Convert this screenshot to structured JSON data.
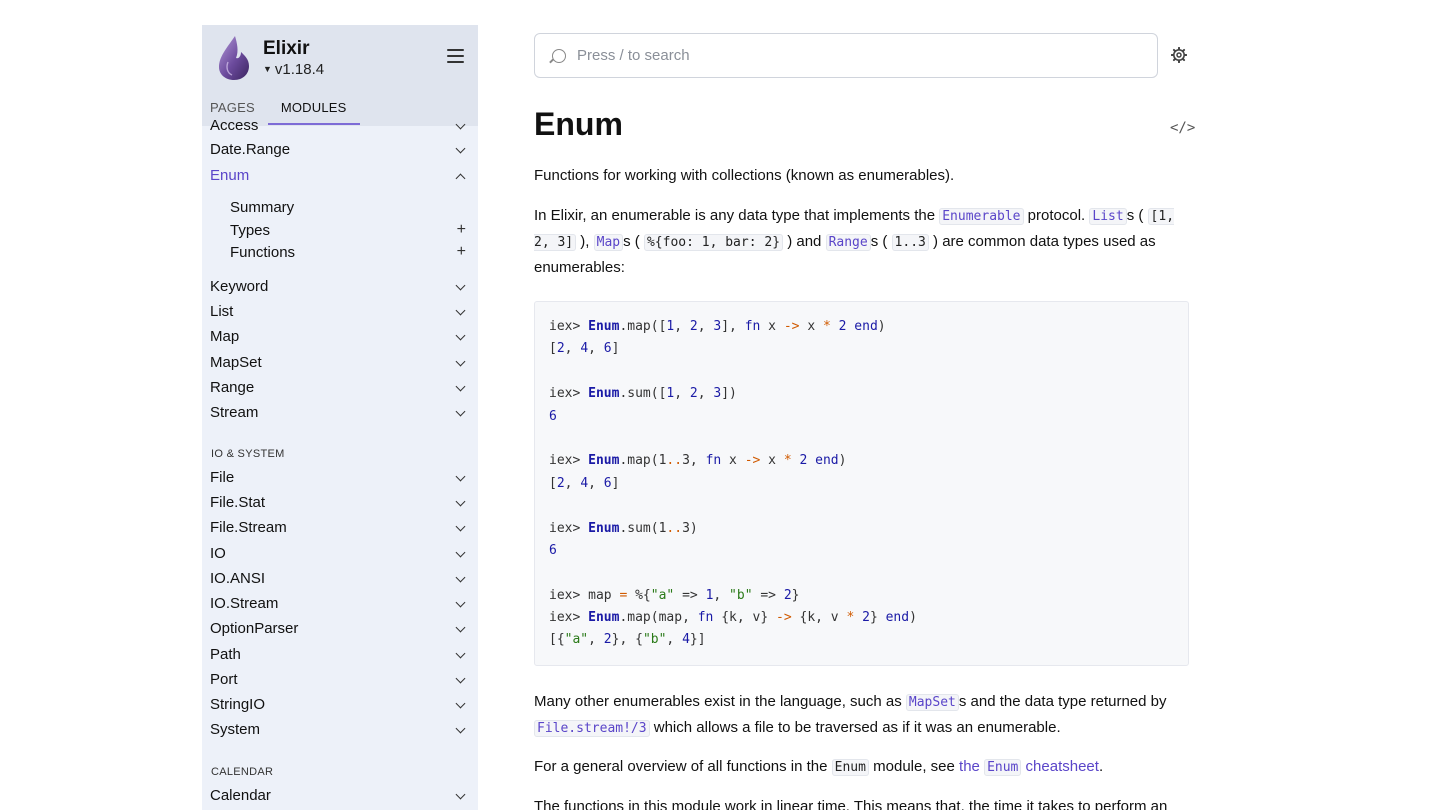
{
  "sidebar": {
    "project_name": "Elixir",
    "version": "v1.18.4",
    "tabs": [
      "PAGES",
      "MODULES"
    ],
    "active_tab": "MODULES",
    "partial_item": "Access",
    "items_top": [
      "Date.Range",
      "Enum"
    ],
    "enum_sections": [
      "Summary",
      "Types",
      "Functions"
    ],
    "items_mid": [
      "Keyword",
      "List",
      "Map",
      "MapSet",
      "Range",
      "Stream"
    ],
    "group_io": "IO & SYSTEM",
    "items_io": [
      "File",
      "File.Stat",
      "File.Stream",
      "IO",
      "IO.ANSI",
      "IO.Stream",
      "OptionParser",
      "Path",
      "Port",
      "StringIO",
      "System"
    ],
    "group_calendar": "CALENDAR",
    "items_calendar": [
      "Calendar"
    ]
  },
  "search": {
    "placeholder": "Press / to search"
  },
  "main": {
    "title": "Enum",
    "code_icon": "</>",
    "intro": "Functions for working with collections (known as enumerables).",
    "p2": {
      "t1": "In Elixir, an enumerable is any data type that implements the ",
      "c1": "Enumerable",
      "t2": " protocol. ",
      "c2": "List",
      "t3": "s ( ",
      "c3": "[1, 2, 3]",
      "t4": " ), ",
      "c4": "Map",
      "t5": "s ( ",
      "c5": "%{foo: 1, bar: 2}",
      "t6": " ) and ",
      "c6": "Range",
      "t7": "s ( ",
      "c7": "1..3",
      "t8": " ) are common data types used as enumerables:"
    },
    "code_lines": [
      "iex> Enum.map([1, 2, 3], fn x -> x * 2 end)",
      "[2, 4, 6]",
      "",
      "iex> Enum.sum([1, 2, 3])",
      "6",
      "",
      "iex> Enum.map(1..3, fn x -> x * 2 end)",
      "[2, 4, 6]",
      "",
      "iex> Enum.sum(1..3)",
      "6",
      "",
      "iex> map = %{\"a\" => 1, \"b\" => 2}",
      "iex> Enum.map(map, fn {k, v} -> {k, v * 2} end)",
      "[{\"a\", 2}, {\"b\", 4}]"
    ],
    "p3": {
      "t1": "Many other enumerables exist in the language, such as ",
      "c1": "MapSet",
      "t2": "s and the data type returned by ",
      "c2": "File.stream!/3",
      "t3": " which allows a file to be traversed as if it was an enumerable."
    },
    "p4": {
      "t1": "For a general overview of all functions in the ",
      "c1": "Enum",
      "t2": " module, see ",
      "l1": "the ",
      "c2": "Enum",
      "l2": " cheatsheet",
      "t3": "."
    },
    "p5": "The functions in this module work in linear time. This means that, the time it takes to perform an"
  },
  "colors": {
    "accent": "#5a45c9",
    "sidebar_bg": "#edf1f9",
    "header_bg": "#dfe4ee"
  }
}
